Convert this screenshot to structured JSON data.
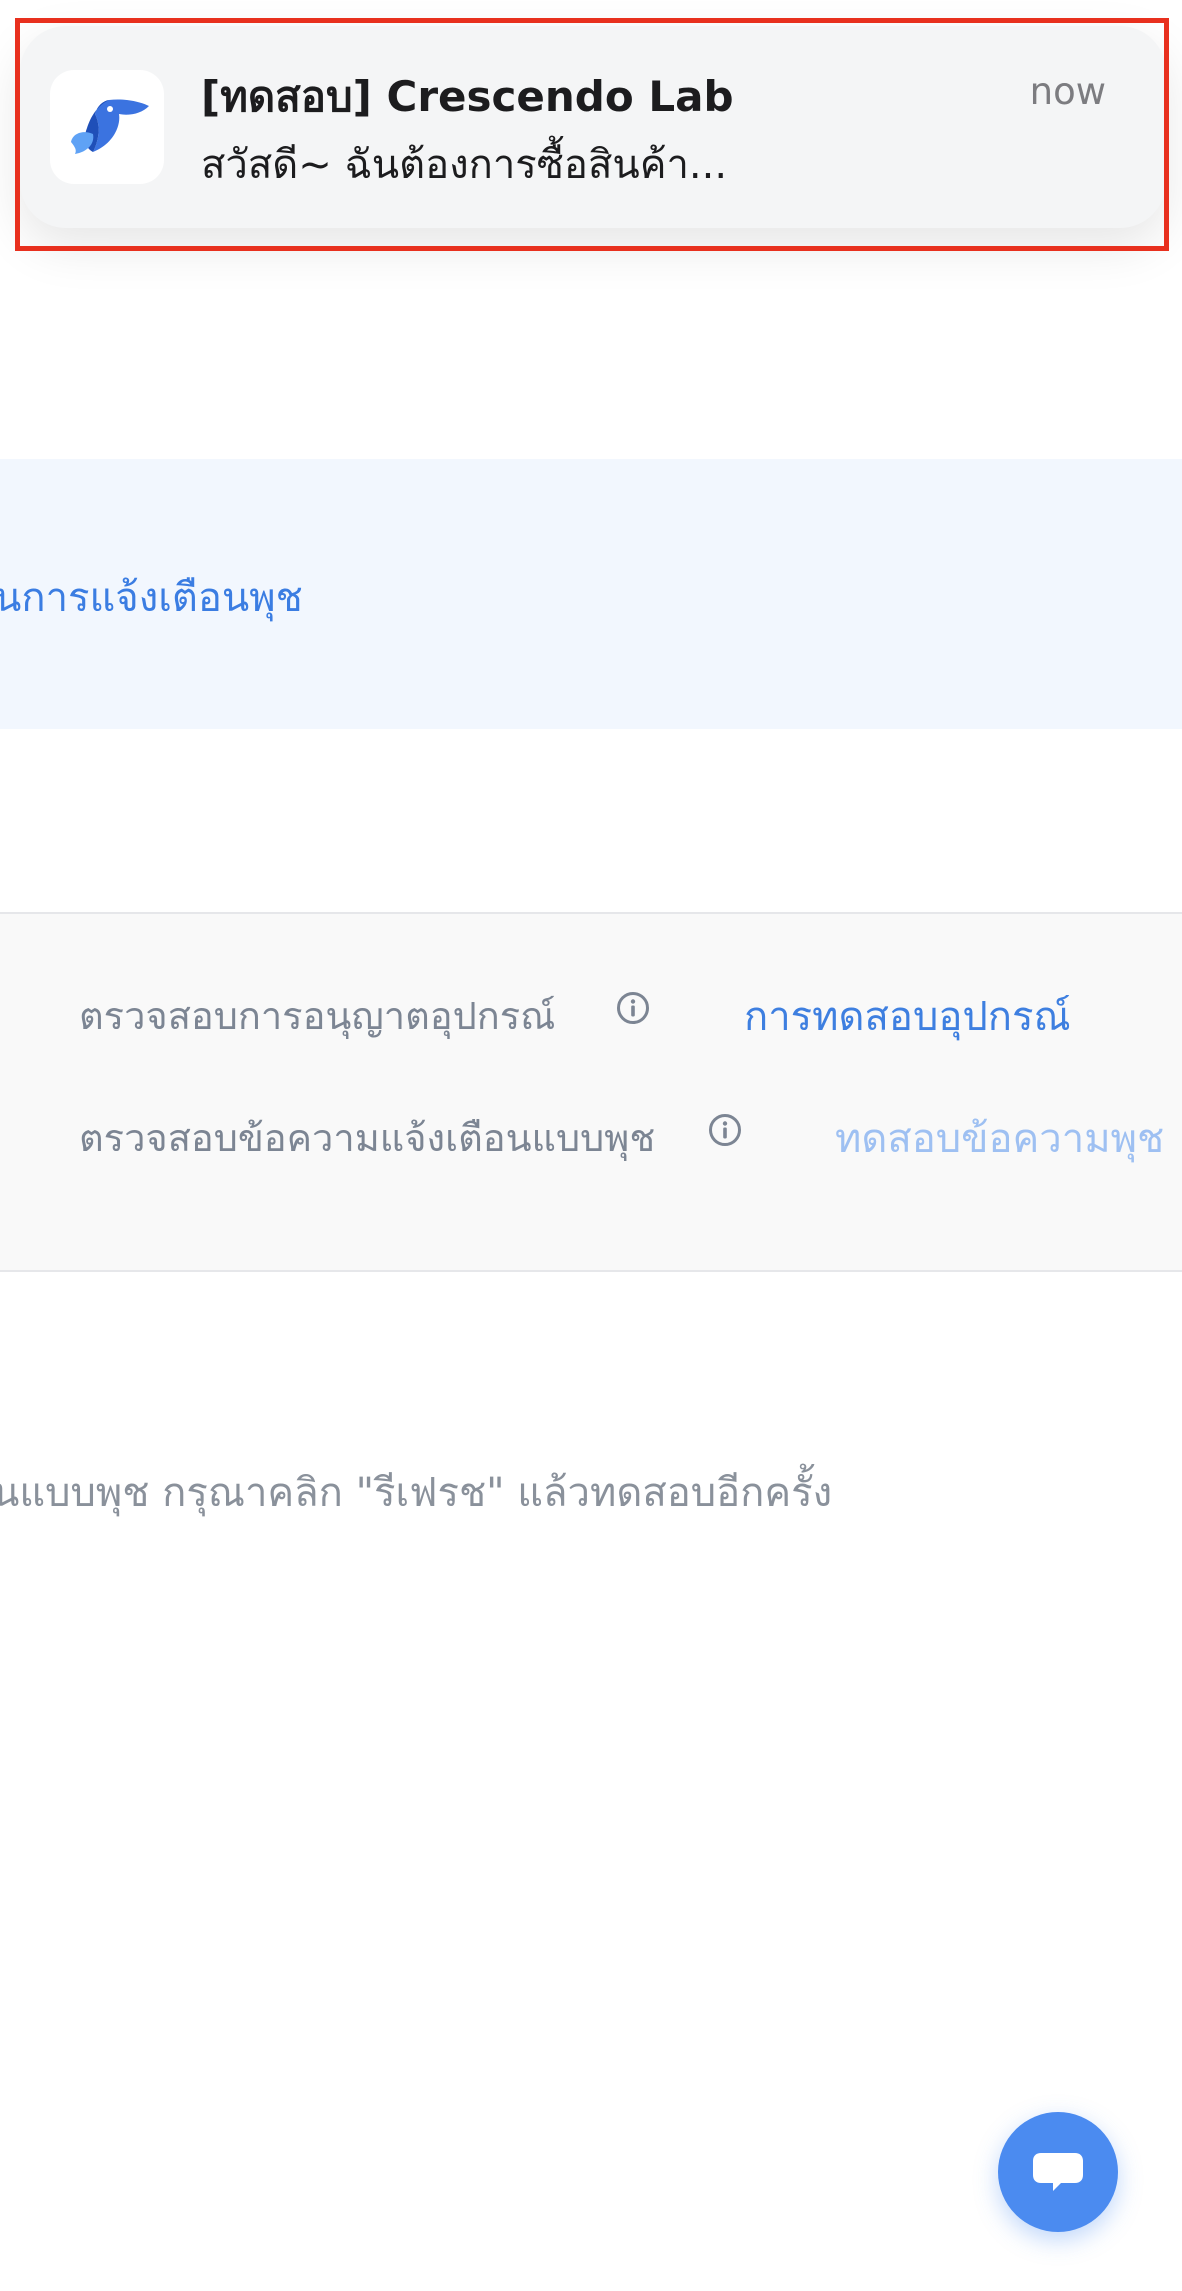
{
  "notification": {
    "title": "[ทดสอบ] Crescendo Lab",
    "body": "สวัสดี~ ฉันต้องการซื้อสินค้า...",
    "time": "now",
    "app_icon": "crescendo-lab-logo-icon",
    "highlight_color": "#e8301e"
  },
  "banner": {
    "text": "นการแจ้งเตือนพุช"
  },
  "checks": [
    {
      "label": "ตรวจสอบการอนุญาตอุปกรณ์",
      "info_icon": "info-icon",
      "action_label": "การทดสอบอุปกรณ์",
      "action_enabled": true
    },
    {
      "label": "ตรวจสอบข้อความแจ้งเตือนแบบพุช",
      "info_icon": "info-icon",
      "action_label": "ทดสอบข้อความพุช",
      "action_enabled": false
    }
  ],
  "hint": {
    "text": "นแบบพุช กรุณาคลิก \"รีเฟรช\" แล้วทดสอบอีกครั้ง"
  },
  "chat_button": {
    "icon": "chat-bubble-icon",
    "color": "#4b8bf0"
  }
}
